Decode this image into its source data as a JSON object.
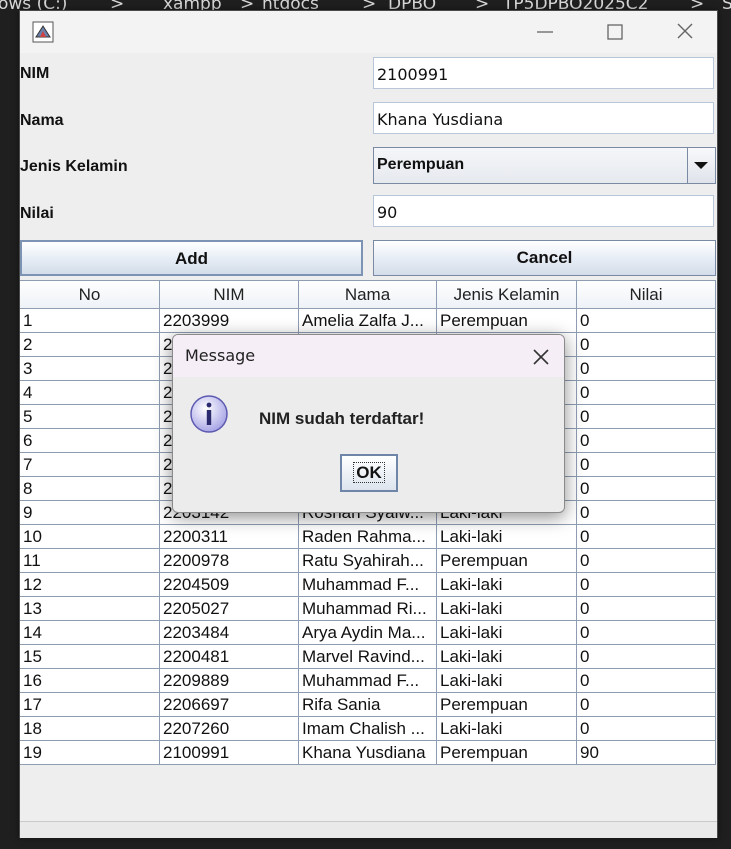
{
  "background_path": [
    "ows (C:)",
    ">",
    "xampp",
    ">",
    "htdocs",
    ">",
    "DPBO",
    ">",
    "TP5DPBO2025C2",
    ">",
    "S"
  ],
  "form": {
    "nim_label": "NIM",
    "nim_value": "2100991",
    "nama_label": "Nama",
    "nama_value": "Khana Yusdiana",
    "jk_label": "Jenis Kelamin",
    "jk_value": "Perempuan",
    "nilai_label": "Nilai",
    "nilai_value": "90",
    "add_label": "Add",
    "cancel_label": "Cancel"
  },
  "table": {
    "headers": [
      "No",
      "NIM",
      "Nama",
      "Jenis Kelamin",
      "Nilai"
    ],
    "rows": [
      [
        "1",
        "2203999",
        "Amelia Zalfa J...",
        "Perempuan",
        "0"
      ],
      [
        "2",
        "2",
        "",
        "",
        "0"
      ],
      [
        "3",
        "2",
        "",
        "",
        "0"
      ],
      [
        "4",
        "2",
        "",
        "",
        "0"
      ],
      [
        "5",
        "2",
        "",
        "",
        "0"
      ],
      [
        "6",
        "2",
        "",
        "",
        "0"
      ],
      [
        "7",
        "2",
        "",
        "",
        "0"
      ],
      [
        "8",
        "2",
        "",
        "",
        "0"
      ],
      [
        "9",
        "2203142",
        "Roshan Syalw...",
        "Laki-laki",
        "0"
      ],
      [
        "10",
        "2200311",
        "Raden Rahma...",
        "Laki-laki",
        "0"
      ],
      [
        "11",
        "2200978",
        "Ratu Syahirah...",
        "Perempuan",
        "0"
      ],
      [
        "12",
        "2204509",
        "Muhammad F...",
        "Laki-laki",
        "0"
      ],
      [
        "13",
        "2205027",
        "Muhammad Ri...",
        "Laki-laki",
        "0"
      ],
      [
        "14",
        "2203484",
        "Arya Aydin Ma...",
        "Laki-laki",
        "0"
      ],
      [
        "15",
        "2200481",
        "Marvel Ravind...",
        "Laki-laki",
        "0"
      ],
      [
        "16",
        "2209889",
        "Muhammad F...",
        "Laki-laki",
        "0"
      ],
      [
        "17",
        "2206697",
        "Rifa Sania",
        "Perempuan",
        "0"
      ],
      [
        "18",
        "2207260",
        "Imam Chalish ...",
        "Laki-laki",
        "0"
      ],
      [
        "19",
        "2100991",
        "Khana Yusdiana",
        "Perempuan",
        "90"
      ]
    ]
  },
  "dialog": {
    "title": "Message",
    "message": "NIM sudah terdaftar!",
    "ok_label": "OK",
    "icon": "info-icon"
  },
  "icons": {
    "app": "java-app-icon",
    "minimize": "minimize-icon",
    "maximize": "maximize-icon",
    "close": "close-icon",
    "dropdown": "chevron-down-icon"
  }
}
